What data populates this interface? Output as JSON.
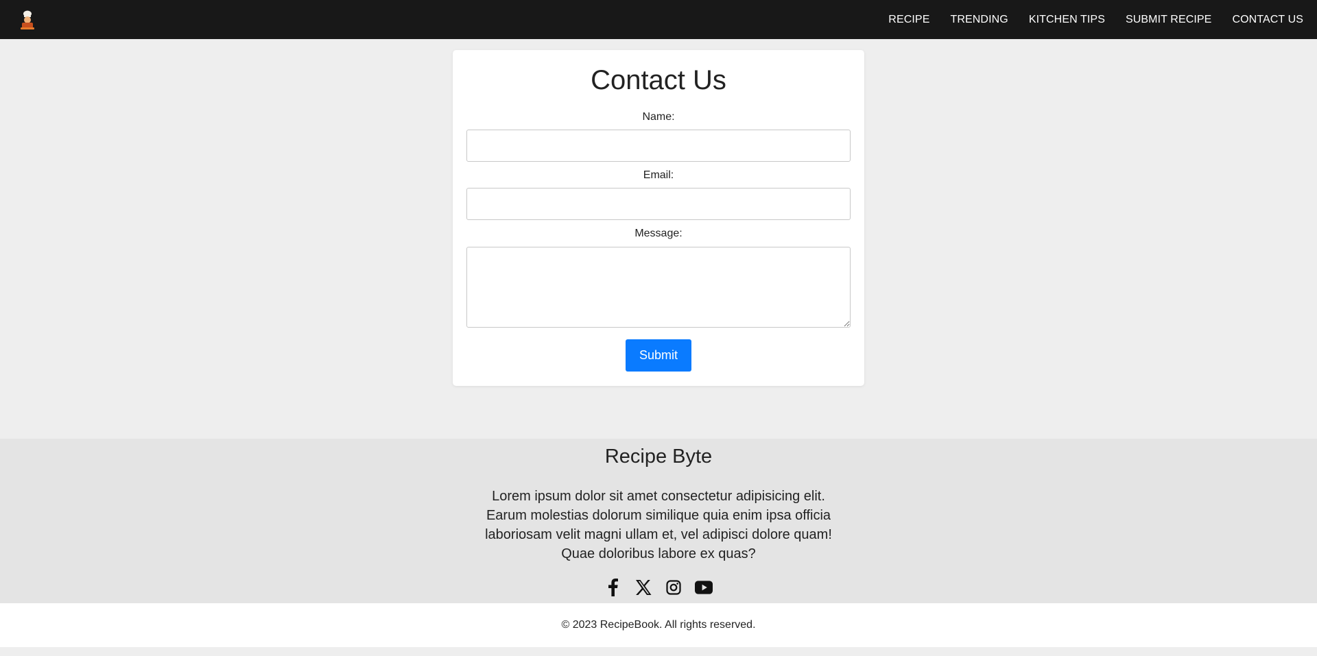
{
  "nav": {
    "logo_icon": "chef-logo-icon",
    "links": [
      "RECIPE",
      "TRENDING",
      "KITCHEN TIPS",
      "SUBMIT RECIPE",
      "CONTACT US"
    ]
  },
  "contact": {
    "title": "Contact Us",
    "name_label": "Name:",
    "name_value": "",
    "email_label": "Email:",
    "email_value": "",
    "message_label": "Message:",
    "message_value": "",
    "submit_label": "Submit",
    "accent_color": "#0a7bff"
  },
  "footer": {
    "brand": "Recipe Byte",
    "description": "Lorem ipsum dolor sit amet consectetur adipisicing elit. Earum molestias dolorum similique quia enim ipsa officia laboriosam velit magni ullam et, vel adipisci dolore quam! Quae doloribus labore ex quas?",
    "social_icons": [
      "facebook-icon",
      "x-icon",
      "instagram-icon",
      "youtube-icon"
    ],
    "copyright": "© 2023 RecipeBook. All rights reserved."
  }
}
